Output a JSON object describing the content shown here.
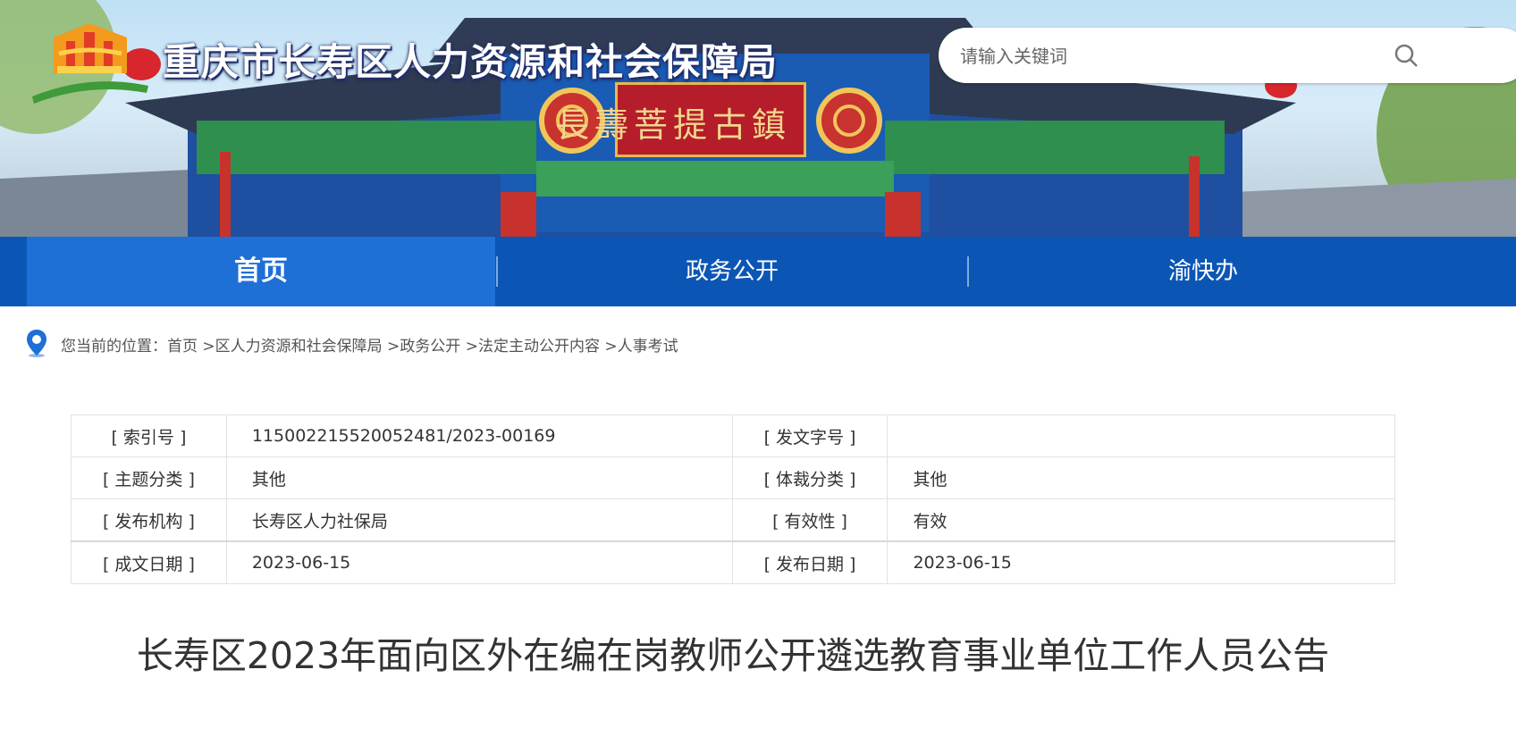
{
  "header": {
    "site_title": "重庆市长寿区人力资源和社会保障局",
    "plaque_text": "長壽菩提古鎮",
    "search": {
      "placeholder": "请输入关键词"
    }
  },
  "nav": {
    "items": [
      {
        "label": "首页",
        "active": true
      },
      {
        "label": "政务公开",
        "active": false
      },
      {
        "label": "渝快办",
        "active": false
      }
    ]
  },
  "breadcrumb": {
    "prefix": "您当前的位置：",
    "items": [
      "首页",
      "区人力资源和社会保障局",
      "政务公开",
      "法定主动公开内容",
      "人事考试"
    ],
    "separator": " >"
  },
  "meta": {
    "rows": [
      [
        {
          "label": "[ 索引号 ]",
          "value": "11500221552005248​1/2023-00169"
        },
        {
          "label": "[ 发文字号 ]",
          "value": ""
        }
      ],
      [
        {
          "label": "[ 主题分类 ]",
          "value": "其他"
        },
        {
          "label": "[ 体裁分类 ]",
          "value": "其他"
        }
      ],
      [
        {
          "label": "[ 发布机构 ]",
          "value": "长寿区人力社保局"
        },
        {
          "label": "[ 有效性 ]",
          "value": "有效"
        }
      ],
      [
        {
          "label": "[ 成文日期 ]",
          "value": "2023-06-15"
        },
        {
          "label": "[ 发布日期 ]",
          "value": "2023-06-15"
        }
      ]
    ]
  },
  "article": {
    "title": "长寿区2023年面向区外在编在岗教师公开遴选教育事业单位工作人员公告"
  },
  "colors": {
    "nav_bg": "#0b56b5",
    "nav_active": "#1e6fd6",
    "plaque_red": "#b51d2a"
  }
}
